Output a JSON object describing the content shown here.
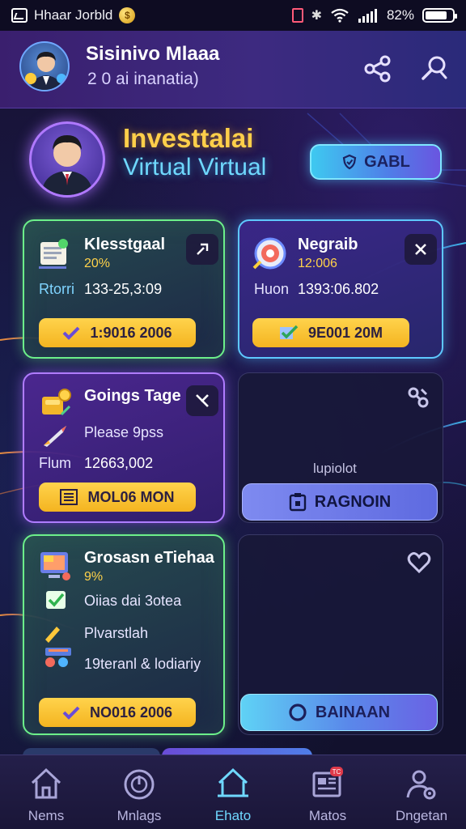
{
  "status_bar": {
    "app_name": "Hhaar Jorbld",
    "coin_glyph": "$",
    "battery_text": "82%",
    "battery_level": 0.82
  },
  "header": {
    "title": "Sisinivo Mlaaa",
    "subtitle": "2 0 ai inanatia)"
  },
  "profile": {
    "name": "Investtalai",
    "subtitle": "Virtual Virtual",
    "button_label": "GABL"
  },
  "cards": {
    "card1": {
      "title": "Klesstgaal",
      "percent": "20%",
      "label": "Rtorri",
      "value": "133-25,3:09",
      "button": "1:9016 2006"
    },
    "card2": {
      "title": "Negraib",
      "percent": "12:006",
      "label": "Huon",
      "value": "1393:06.802",
      "button": "9E001 20M"
    },
    "card3": {
      "title": "Goings Tage",
      "line": "Please 9pss",
      "label": "Flum",
      "value": "12663,002",
      "button": "MOL06 MON"
    },
    "card4": {
      "caption": "lupiolot",
      "button": "RAGNOIN"
    },
    "card5": {
      "title": "Grosasn eTiehaa",
      "percent": "9%",
      "check_line": "Oiias dai 3otea",
      "line2": "Plvarstlah",
      "line3": "19teranl & lodiariy",
      "button": "NO016 2006"
    },
    "card6": {
      "button": "BAINAAN"
    }
  },
  "bottom_nav": [
    {
      "label": "Nems",
      "icon": "home-icon"
    },
    {
      "label": "Mnlags",
      "icon": "gauge-icon"
    },
    {
      "label": "Ehato",
      "icon": "house-outline-icon"
    },
    {
      "label": "Matos",
      "icon": "news-icon",
      "badge": "TC"
    },
    {
      "label": "Dngetan",
      "icon": "user-gear-icon"
    }
  ],
  "colors": {
    "accent_gold": "#ffcf4a",
    "accent_cyan": "#6fd8ff",
    "card_green": "#6cf08a",
    "card_purple": "#b07cff",
    "button_yellow": "#f4b420"
  }
}
